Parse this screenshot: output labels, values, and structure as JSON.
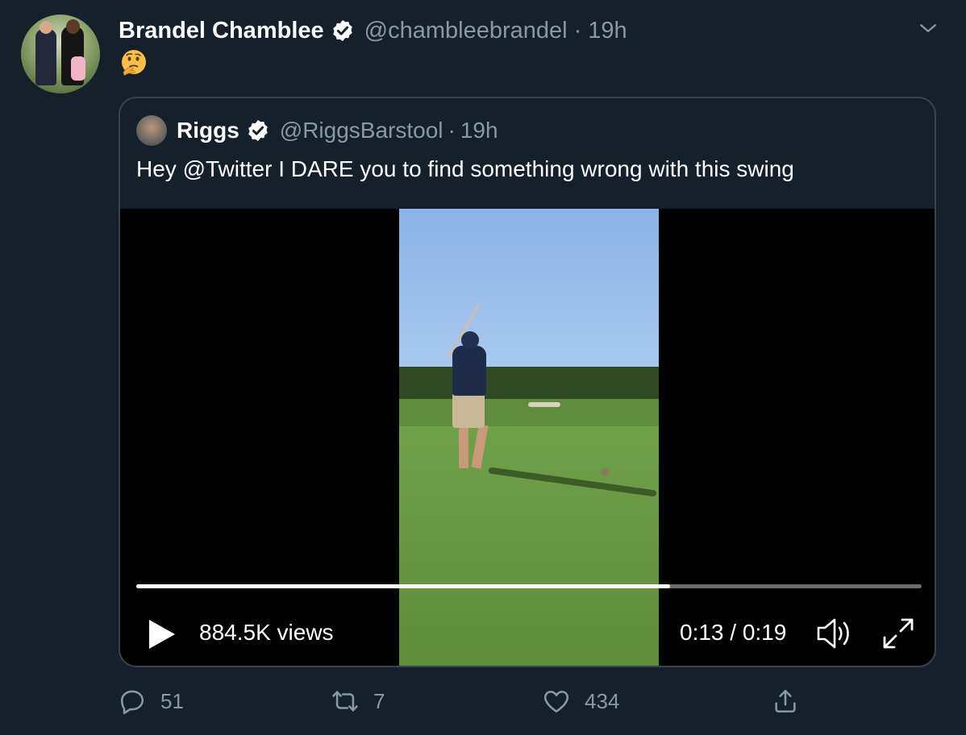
{
  "tweet": {
    "author_name": "Brandel Chamblee",
    "author_handle": "@chambleebrandel",
    "separator": "·",
    "time": "19h",
    "body_emoji": "thinking-face-emoji",
    "avatar_icon": "avatar-photo"
  },
  "quote": {
    "author_name": "Riggs",
    "author_handle": "@RiggsBarstool",
    "separator": "·",
    "time": "19h",
    "text": "Hey @Twitter I DARE you to find something wrong with this swing",
    "video": {
      "views": "884.5K views",
      "timer": "0:13 / 0:19",
      "progress": 0.68
    }
  },
  "actions": {
    "reply_count": "51",
    "retweet_count": "7",
    "like_count": "434"
  },
  "colors": {
    "background": "#15202b",
    "secondary_text": "#8899a6",
    "border": "#38444d",
    "primary_text": "#ffffff"
  }
}
